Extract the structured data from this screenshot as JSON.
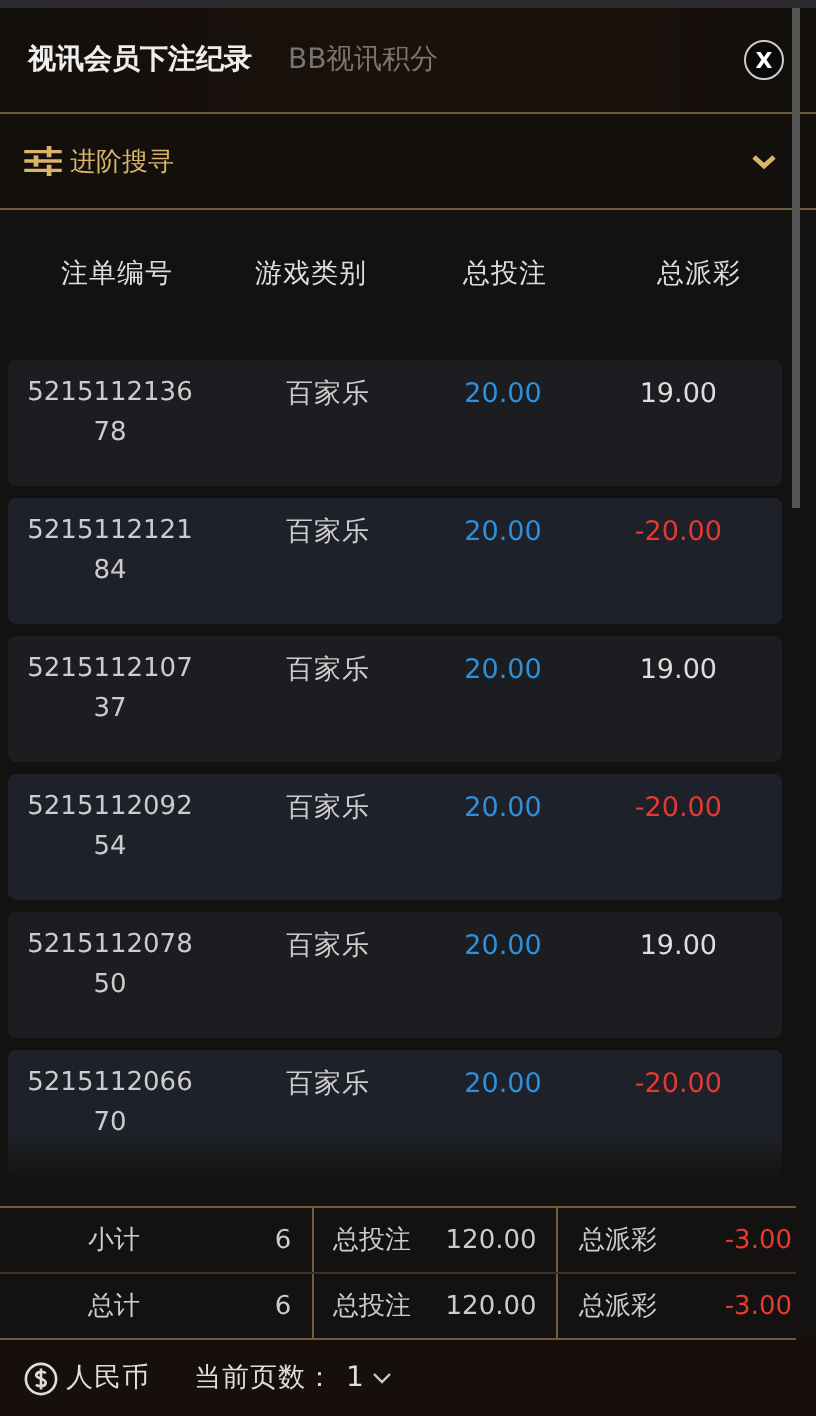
{
  "tabs": [
    {
      "label": "视讯会员下注纪录",
      "selected": true
    },
    {
      "label": "BB视讯积分",
      "selected": false
    }
  ],
  "close": "X",
  "advanced_search": {
    "label": "进阶搜寻",
    "expanded": false
  },
  "table": {
    "columns": [
      "注单编号",
      "游戏类别",
      "总投注",
      "总派彩"
    ],
    "rows": [
      {
        "id": "521511213678",
        "game": "百家乐",
        "bet": "20.00",
        "payout": "19.00",
        "kind": "win"
      },
      {
        "id": "521511212184",
        "game": "百家乐",
        "bet": "20.00",
        "payout": "-20.00",
        "kind": "loss"
      },
      {
        "id": "521511210737",
        "game": "百家乐",
        "bet": "20.00",
        "payout": "19.00",
        "kind": "win"
      },
      {
        "id": "521511209254",
        "game": "百家乐",
        "bet": "20.00",
        "payout": "-20.00",
        "kind": "loss"
      },
      {
        "id": "521511207850",
        "game": "百家乐",
        "bet": "20.00",
        "payout": "19.00",
        "kind": "win"
      },
      {
        "id": "521511206670",
        "game": "百家乐",
        "bet": "20.00",
        "payout": "-20.00",
        "kind": "loss"
      }
    ]
  },
  "summary": [
    {
      "label": "小计",
      "count": "6",
      "bet_label": "总投注",
      "bet": "120.00",
      "payout_label": "总派彩",
      "payout": "-3.00",
      "kind": "loss"
    },
    {
      "label": "总计",
      "count": "6",
      "bet_label": "总投注",
      "bet": "120.00",
      "payout_label": "总派彩",
      "payout": "-3.00",
      "kind": "loss"
    }
  ],
  "footer": {
    "currency": "人民币",
    "page_label": "当前页数：",
    "page": "1"
  }
}
